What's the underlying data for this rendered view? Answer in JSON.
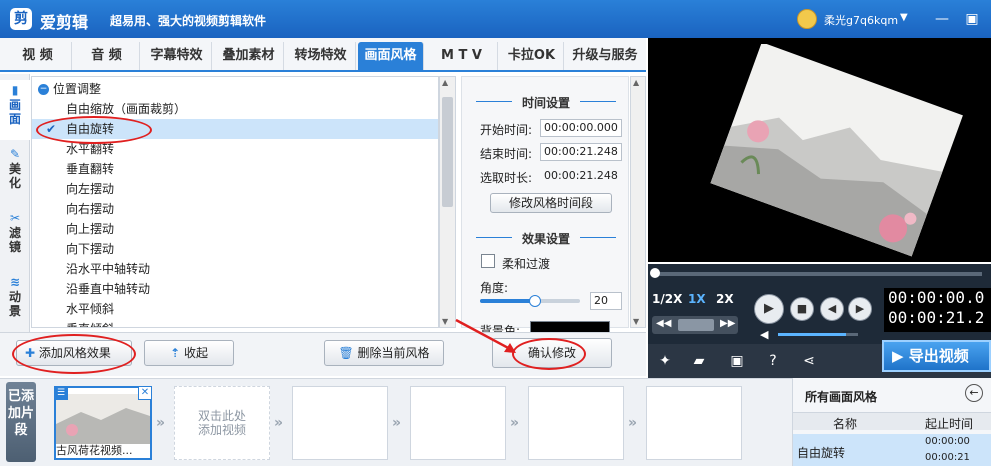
{
  "app": {
    "name": "爱剪辑",
    "slogan": "超易用、强大的视频剪辑软件",
    "logo_glyph": "剪",
    "username": "柔光g7q6kqm"
  },
  "tabs": [
    "视 频",
    "音 频",
    "字幕特效",
    "叠加素材",
    "转场特效",
    "画面风格",
    "M T V",
    "卡拉OK",
    "升级与服务"
  ],
  "active_tab": "画面风格",
  "sidenav": {
    "items": [
      {
        "label": "画\n面",
        "icon": "▮"
      },
      {
        "label": "美\n化",
        "icon": "✎"
      },
      {
        "label": "滤\n镜",
        "icon": "✂"
      },
      {
        "label": "动\n景",
        "icon": "≋"
      }
    ]
  },
  "effect_list": {
    "group": "位置调整",
    "items": [
      "自由缩放（画面裁剪）",
      "自由旋转",
      "水平翻转",
      "垂直翻转",
      "向左摆动",
      "向右摆动",
      "向上摆动",
      "向下摆动",
      "沿水平中轴转动",
      "沿垂直中轴转动",
      "水平倾斜",
      "垂直倾斜"
    ],
    "selected": "自由旋转"
  },
  "settings": {
    "time_title": "时间设置",
    "start_label": "开始时间:",
    "start_value": "00:00:00.000",
    "end_label": "结束时间:",
    "end_value": "00:00:21.248",
    "duration_label": "选取时长:",
    "duration_value": "00:00:21.248",
    "modify_time_button": "修改风格时间段",
    "effect_title": "效果设置",
    "smooth_label": "柔和过渡",
    "smooth_checked": false,
    "angle_label": "角度:",
    "angle_value": "20",
    "angle_slider_fraction": 0.55,
    "bg_color_label": "背景色:",
    "bg_color": "#000000"
  },
  "actions": {
    "add_style": "添加风格效果",
    "collapse": "收起",
    "delete_style": "删除当前风格",
    "confirm": "确认修改"
  },
  "player": {
    "speed_options": [
      "1/2X",
      "1X",
      "2X"
    ],
    "active_speed": "1X",
    "timecode_current": "00:00:00.0",
    "timecode_total": "00:00:21.2",
    "volume_fraction": 0.85,
    "export_label": "导出视频"
  },
  "clips": {
    "strip_label": "已添加片段",
    "first_clip_name": "古风荷花视频...",
    "placeholder_hint": "双击此处\n添加视频"
  },
  "styles_panel": {
    "title": "所有画面风格",
    "col_name": "名称",
    "col_time": "起止时间",
    "row_name": "自由旋转",
    "row_start": "00:00:00",
    "row_end": "00:00:21"
  },
  "colors": {
    "accent": "#2a80d8",
    "titlebar": "#1a63c0",
    "selection": "#cce4fa",
    "annotation": "#e02020"
  }
}
